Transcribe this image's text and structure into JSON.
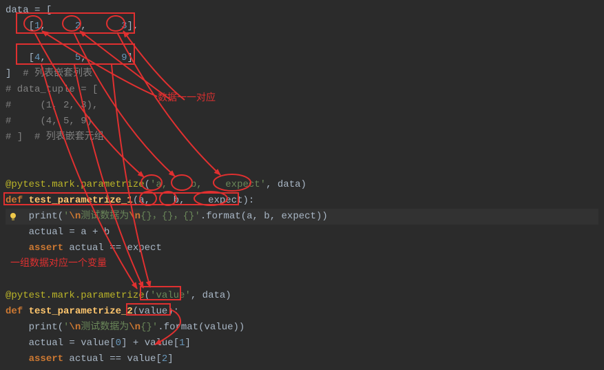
{
  "code_lines": [
    [
      {
        "c": "param",
        "t": "data "
      },
      {
        "c": "op",
        "t": "= ["
      }
    ],
    [
      {
        "c": "op",
        "t": "    ["
      },
      {
        "c": "num",
        "t": "1"
      },
      {
        "c": "op",
        "t": ",     "
      },
      {
        "c": "num",
        "t": "2"
      },
      {
        "c": "op",
        "t": ",      "
      },
      {
        "c": "num",
        "t": "3"
      },
      {
        "c": "op",
        "t": "],"
      }
    ],
    [
      {
        "c": "op",
        "t": ""
      }
    ],
    [
      {
        "c": "op",
        "t": "    ["
      },
      {
        "c": "num",
        "t": "4"
      },
      {
        "c": "op",
        "t": ",     "
      },
      {
        "c": "num",
        "t": "5"
      },
      {
        "c": "op",
        "t": ",      "
      },
      {
        "c": "num",
        "t": "9"
      },
      {
        "c": "op",
        "t": "]"
      }
    ],
    [
      {
        "c": "op",
        "t": "]  "
      },
      {
        "c": "cmt",
        "t": "# 列表嵌套列表"
      }
    ],
    [
      {
        "c": "cmt",
        "t": "# data_tuple = ["
      }
    ],
    [
      {
        "c": "cmt",
        "t": "#     (1, 2, 3),"
      }
    ],
    [
      {
        "c": "cmt",
        "t": "#     (4, 5, 9)"
      }
    ],
    [
      {
        "c": "cmt",
        "t": "# ]  # 列表嵌套元组"
      }
    ],
    [
      {
        "c": "op",
        "t": ""
      }
    ],
    [
      {
        "c": "op",
        "t": ""
      }
    ],
    [
      {
        "c": "deco",
        "t": "@pytest.mark.parametrize"
      },
      {
        "c": "op",
        "t": "("
      },
      {
        "c": "str",
        "t": "'a,    b,    expect'"
      },
      {
        "c": "op",
        "t": ", "
      },
      {
        "c": "param",
        "t": "data"
      },
      {
        "c": "op",
        "t": ")"
      }
    ],
    [
      {
        "c": "kw",
        "t": "def "
      },
      {
        "c": "fn",
        "t": "test_parametrize_1"
      },
      {
        "c": "op",
        "t": "("
      },
      {
        "c": "param",
        "t": "a"
      },
      {
        "c": "op",
        "t": ",    "
      },
      {
        "c": "param",
        "t": "b"
      },
      {
        "c": "op",
        "t": ",    "
      },
      {
        "c": "param",
        "t": "expect"
      },
      {
        "c": "op",
        "t": "):"
      }
    ],
    [
      {
        "c": "op",
        "t": "    print("
      },
      {
        "c": "str",
        "t": "'"
      },
      {
        "c": "esc",
        "t": "\\n"
      },
      {
        "c": "str",
        "t": "测试数据为"
      },
      {
        "c": "esc",
        "t": "\\n"
      },
      {
        "c": "str",
        "t": "{}，{}，{}'"
      },
      {
        "c": "op",
        "t": ".format("
      },
      {
        "c": "param",
        "t": "a"
      },
      {
        "c": "op",
        "t": ", "
      },
      {
        "c": "param",
        "t": "b"
      },
      {
        "c": "op",
        "t": ", "
      },
      {
        "c": "param",
        "t": "expect"
      },
      {
        "c": "op",
        "t": "))"
      }
    ],
    [
      {
        "c": "op",
        "t": "    actual "
      },
      {
        "c": "op",
        "t": "= "
      },
      {
        "c": "param",
        "t": "a "
      },
      {
        "c": "op",
        "t": "+ "
      },
      {
        "c": "param",
        "t": "b"
      }
    ],
    [
      {
        "c": "op",
        "t": "    "
      },
      {
        "c": "kw",
        "t": "assert "
      },
      {
        "c": "param",
        "t": "actual "
      },
      {
        "c": "op",
        "t": "== "
      },
      {
        "c": "param",
        "t": "expect"
      }
    ],
    [
      {
        "c": "op",
        "t": ""
      }
    ],
    [
      {
        "c": "op",
        "t": ""
      }
    ],
    [
      {
        "c": "deco",
        "t": "@pytest.mark.parametrize"
      },
      {
        "c": "op",
        "t": "("
      },
      {
        "c": "str",
        "t": "'value'"
      },
      {
        "c": "op",
        "t": ", "
      },
      {
        "c": "param",
        "t": "data"
      },
      {
        "c": "op",
        "t": ")"
      }
    ],
    [
      {
        "c": "kw",
        "t": "def "
      },
      {
        "c": "fn",
        "t": "test_parametrize_2"
      },
      {
        "c": "op",
        "t": "("
      },
      {
        "c": "param",
        "t": "value"
      },
      {
        "c": "op",
        "t": "):"
      }
    ],
    [
      {
        "c": "op",
        "t": "    print("
      },
      {
        "c": "str",
        "t": "'"
      },
      {
        "c": "esc",
        "t": "\\n"
      },
      {
        "c": "str",
        "t": "测试数据为"
      },
      {
        "c": "esc",
        "t": "\\n"
      },
      {
        "c": "str",
        "t": "{}'"
      },
      {
        "c": "op",
        "t": ".format("
      },
      {
        "c": "param",
        "t": "value"
      },
      {
        "c": "op",
        "t": "))"
      }
    ],
    [
      {
        "c": "op",
        "t": "    actual "
      },
      {
        "c": "op",
        "t": "= "
      },
      {
        "c": "param",
        "t": "value"
      },
      {
        "c": "op",
        "t": "["
      },
      {
        "c": "num",
        "t": "0"
      },
      {
        "c": "op",
        "t": "] "
      },
      {
        "c": "op",
        "t": "+ "
      },
      {
        "c": "param",
        "t": "value"
      },
      {
        "c": "op",
        "t": "["
      },
      {
        "c": "num",
        "t": "1"
      },
      {
        "c": "op",
        "t": "]"
      }
    ],
    [
      {
        "c": "op",
        "t": "    "
      },
      {
        "c": "kw",
        "t": "assert "
      },
      {
        "c": "param",
        "t": "actual "
      },
      {
        "c": "op",
        "t": "== "
      },
      {
        "c": "param",
        "t": "value"
      },
      {
        "c": "op",
        "t": "["
      },
      {
        "c": "num",
        "t": "2"
      },
      {
        "c": "op",
        "t": "]"
      }
    ]
  ],
  "anno": {
    "label1": "数据一一对应",
    "label2": "一组数据对应一个变量"
  },
  "colors": {
    "red": "#e03030"
  }
}
